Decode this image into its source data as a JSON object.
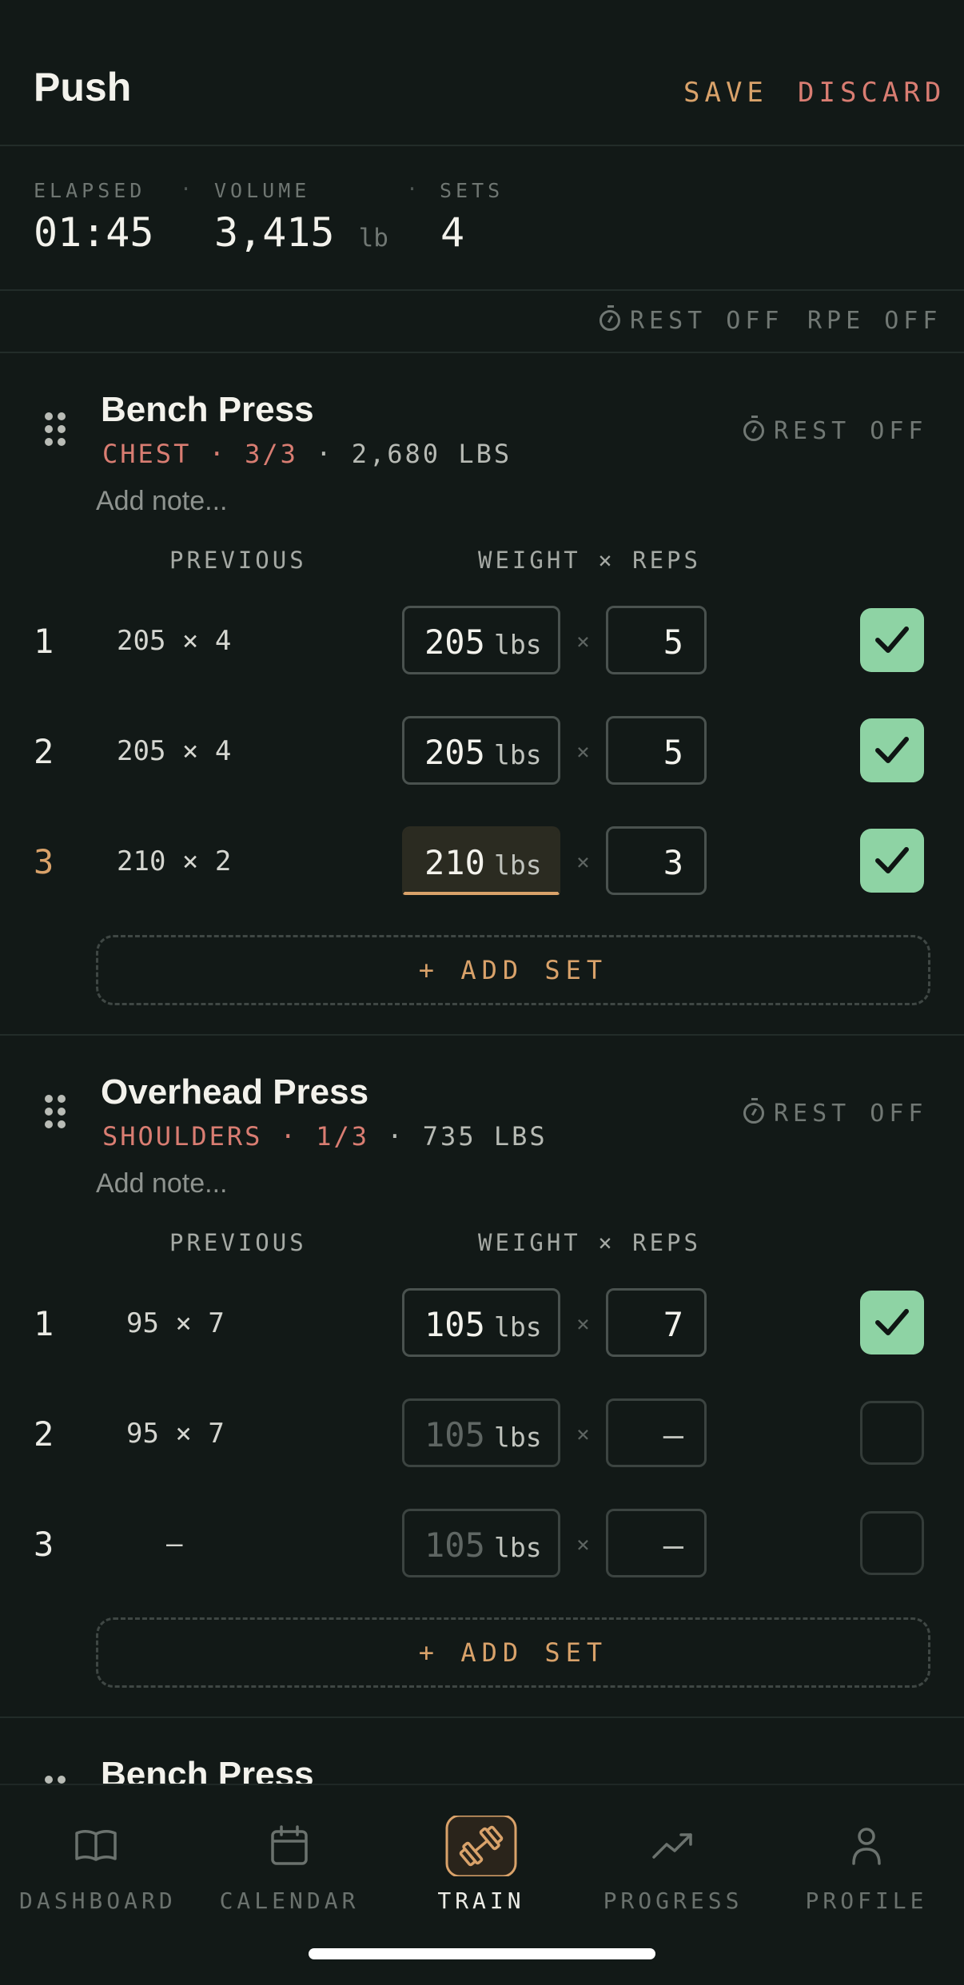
{
  "header": {
    "title": "Push",
    "save_label": "SAVE",
    "discard_label": "DISCARD"
  },
  "stats": {
    "elapsed_label": "ELAPSED",
    "elapsed_value": "01:45",
    "volume_label": "VOLUME",
    "volume_value": "3,415",
    "volume_unit": "lb",
    "sets_label": "SETS",
    "sets_value": "4",
    "separator": "·"
  },
  "toggles": {
    "rest": "REST OFF",
    "rpe": "RPE OFF"
  },
  "columns": {
    "previous": "PREVIOUS",
    "weight_reps": "WEIGHT × REPS"
  },
  "times_symbol": "×",
  "unit": "lbs",
  "exercises": [
    {
      "name": "Bench Press",
      "muscle": "CHEST",
      "dot": "·",
      "progress": "3/3",
      "volume": "2,680 LBS",
      "rest": "REST OFF",
      "note_placeholder": "Add note...",
      "add_set": "+ ADD SET",
      "sets": [
        {
          "num": "1",
          "previous": "205 × 4",
          "weight": "205",
          "reps": "5",
          "done": true
        },
        {
          "num": "2",
          "previous": "205 × 4",
          "weight": "205",
          "reps": "5",
          "done": true
        },
        {
          "num": "3",
          "previous": "210 × 2",
          "weight": "210",
          "reps": "3",
          "done": true
        }
      ]
    },
    {
      "name": "Overhead Press",
      "muscle": "SHOULDERS",
      "dot": "·",
      "progress": "1/3",
      "volume": "735 LBS",
      "rest": "REST OFF",
      "note_placeholder": "Add note...",
      "add_set": "+ ADD SET",
      "sets": [
        {
          "num": "1",
          "previous": "95 × 7",
          "weight": "105",
          "reps": "7",
          "done": true
        },
        {
          "num": "2",
          "previous": "95 × 7",
          "weight": "105",
          "reps": "—",
          "done": false
        },
        {
          "num": "3",
          "previous": "—",
          "weight": "105",
          "reps": "—",
          "done": false
        }
      ]
    },
    {
      "name": "Bench Press"
    }
  ],
  "nav": [
    {
      "label": "DASHBOARD",
      "icon": "book-icon"
    },
    {
      "label": "CALENDAR",
      "icon": "calendar-icon"
    },
    {
      "label": "TRAIN",
      "icon": "dumbbell-icon",
      "active": true
    },
    {
      "label": "PROGRESS",
      "icon": "trend-icon"
    },
    {
      "label": "PROFILE",
      "icon": "person-icon"
    }
  ],
  "colors": {
    "accent": "#d9a26a",
    "danger": "#d97d72",
    "success": "#8ed3a4",
    "background": "#121917"
  }
}
